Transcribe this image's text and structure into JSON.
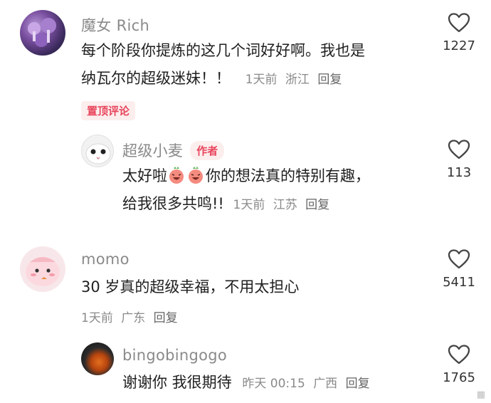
{
  "comments": [
    {
      "user": "魔女 Rich",
      "text_line1": "每个阶段你提炼的这几个词好好啊。我也是",
      "text_line2": "纳瓦尔的超级迷妹！！",
      "time": "1天前",
      "location": "浙江",
      "reply": "回复",
      "badge": "置顶评论",
      "likes": "1227"
    },
    {
      "user": "超级小麦",
      "author_badge": "作者",
      "text_line1": "太好啦",
      "text_line1_rest": "你的想法真的特别有趣，",
      "text_line2": "给我很多共鸣!!",
      "time": "1天前",
      "location": "江苏",
      "reply": "回复",
      "likes": "113"
    },
    {
      "user": "momo",
      "text_line1": "30 岁真的超级幸福，不用太担心",
      "time": "1天前",
      "location": "广东",
      "reply": "回复",
      "likes": "5411"
    },
    {
      "user": "bingobingogo",
      "text_line1": "谢谢你 我很期待",
      "time": "昨天 00:15",
      "location": "广西",
      "reply": "回复",
      "likes": "1765"
    }
  ],
  "icons": {
    "like": "heart-outline-icon",
    "emoji": "laughing-face-emoji"
  },
  "colors": {
    "badge_text": "#e8455c",
    "badge_bg": "#fdeeee",
    "meta": "#8a8a8a"
  }
}
